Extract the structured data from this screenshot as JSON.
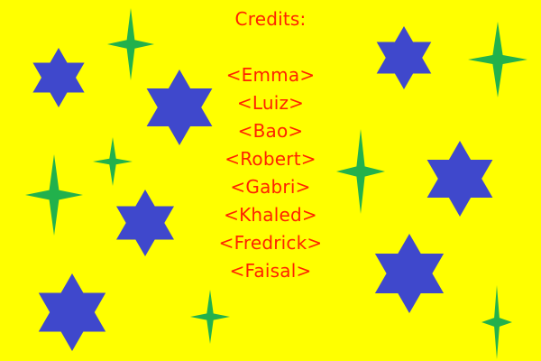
{
  "colors": {
    "background": "#ffff00",
    "text": "#ff2200",
    "hexagram": "#3f48cc",
    "sparkle": "#22b14c"
  },
  "credits": {
    "title": "Credits:",
    "names": [
      "<Emma>",
      "<Luiz>",
      "<Bao>",
      "<Robert>",
      "<Gabri>",
      "<Khaled>",
      "<Fredrick>",
      "<Faisal>"
    ]
  },
  "decorations": {
    "hexagram_icon": "hexagram-star-icon",
    "sparkle_icon": "four-point-sparkle-icon"
  }
}
